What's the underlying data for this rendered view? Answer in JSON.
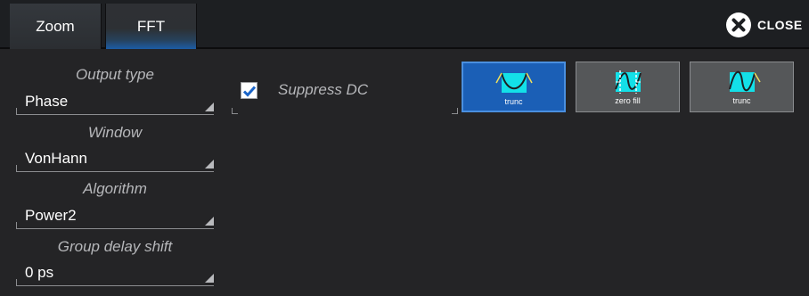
{
  "tabs": {
    "zoom": "Zoom",
    "fft": "FFT"
  },
  "close": {
    "label": "CLOSE",
    "icon": "close-circle-icon"
  },
  "fields": {
    "output_type": {
      "label": "Output type",
      "value": "Phase"
    },
    "window": {
      "label": "Window",
      "value": "VonHann"
    },
    "algorithm": {
      "label": "Algorithm",
      "value": "Power2"
    },
    "group_delay_shift": {
      "label": "Group delay shift",
      "value": "0 ps"
    }
  },
  "suppress_dc": {
    "label": "Suppress DC",
    "checked": true
  },
  "window_buttons": [
    {
      "label": "trunc",
      "icon": "window-trunc-icon",
      "selected": true
    },
    {
      "label": "zero fill",
      "icon": "window-zero-fill-icon",
      "selected": false
    },
    {
      "label": "trunc",
      "icon": "window-trunc-icon",
      "selected": false
    }
  ],
  "colors": {
    "accent": "#1b5fb6",
    "icon_fill": "#13e0e8",
    "background": "#242426"
  }
}
